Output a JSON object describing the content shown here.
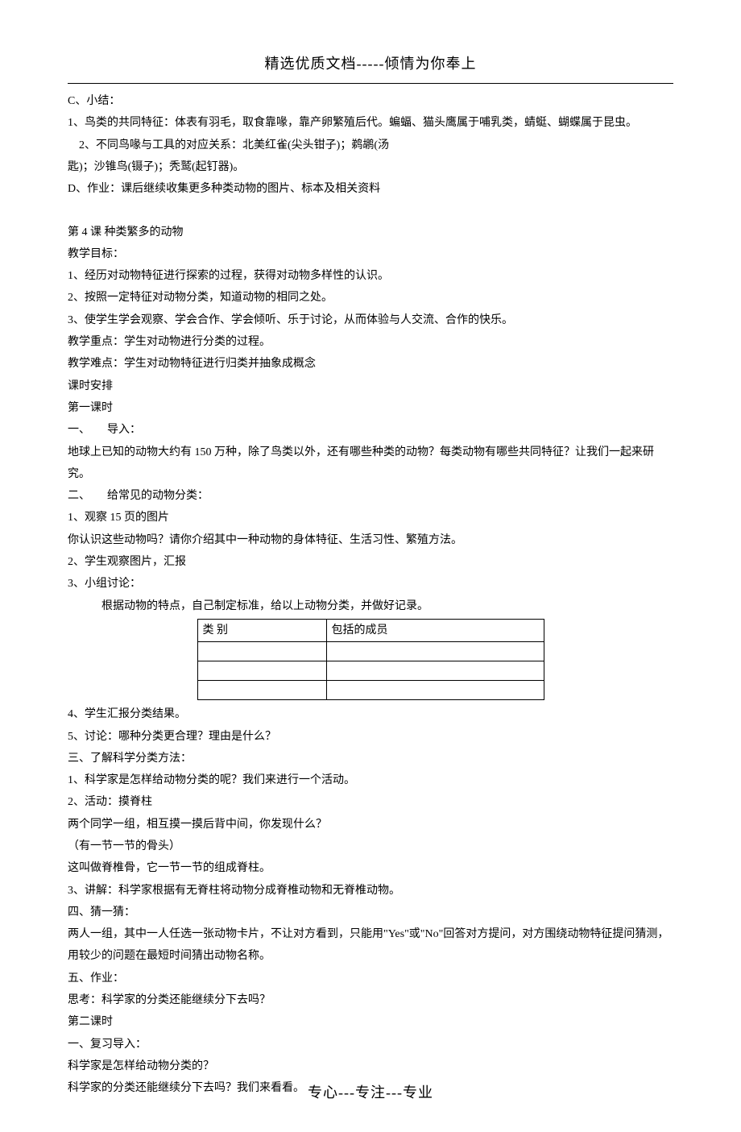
{
  "header": "精选优质文档-----倾情为你奉上",
  "footer": "专心---专注---专业",
  "lines": {
    "c_summary": "C、小结：",
    "c1": "1、鸟类的共同特征：体表有羽毛，取食靠喙，靠产卵繁殖后代。蝙蝠、猫头鹰属于哺乳类，蜻蜓、蝴蝶属于昆虫。",
    "c2a": "2、不同鸟喙与工具的对应关系：北美红雀(尖头钳子)；鹈鹕(汤",
    "c2b": "匙)；沙锥鸟(镊子)；秃鹫(起钉器)。",
    "d_hw": "D、作业：课后继续收集更多种类动物的图片、标本及相关资料",
    "lesson4_title": "第 4 课 种类繁多的动物",
    "obj_label": "教学目标：",
    "obj1": "1、经历对动物特征进行探索的过程，获得对动物多样性的认识。",
    "obj2": "2、按照一定特征对动物分类，知道动物的相同之处。",
    "obj3": "3、使学生学会观察、学会合作、学会倾听、乐于讨论，从而体验与人交流、合作的快乐。",
    "key_point": "教学重点：学生对动物进行分类的过程。",
    "diff_point": "教学难点：学生对动物特征进行归类并抽象成概念",
    "period_label": "课时安排",
    "period1": "第一课时",
    "sec1_label": "一、　　导入：",
    "sec1_text": "地球上已知的动物大约有 150 万种，除了鸟类以外，还有哪些种类的动物？每类动物有哪些共同特征？让我们一起来研究。",
    "sec2_label": "二、　　给常见的动物分类：",
    "sec2_1": "1、观察 15 页的图片",
    "sec2_1a": "你认识这些动物吗？请你介绍其中一种动物的身体特征、生活习性、繁殖方法。",
    "sec2_2": "2、学生观察图片，汇报",
    "sec2_3": "3、小组讨论：",
    "sec2_3a": "根据动物的特点，自己制定标准，给以上动物分类，并做好记录。",
    "th1": "类  别",
    "th2": "包括的成员",
    "sec2_4": "4、学生汇报分类结果。",
    "sec2_5": "5、讨论：哪种分类更合理？理由是什么？",
    "sec3_label": "三、了解科学分类方法：",
    "sec3_1": "1、科学家是怎样给动物分类的呢？我们来进行一个活动。",
    "sec3_2": "2、活动：摸脊柱",
    "sec3_2a": "两个同学一组，相互摸一摸后背中间，你发现什么？",
    "sec3_2b": "（有一节一节的骨头）",
    "sec3_2c": "这叫做脊椎骨，它一节一节的组成脊柱。",
    "sec3_3": "3、讲解：科学家根据有无脊柱将动物分成脊椎动物和无脊椎动物。",
    "sec4_label": "四、猜一猜：",
    "sec4_text": "两人一组，其中一人任选一张动物卡片，不让对方看到，只能用\"Yes\"或\"No\"回答对方提问，对方围绕动物特征提问猜测，用较少的问题在最短时间猜出动物名称。",
    "sec5_label": "五、作业：",
    "sec5_text": "思考：科学家的分类还能继续分下去吗？",
    "period2": "第二课时",
    "review_label": "一、复习导入：",
    "review_q1": "科学家是怎样给动物分类的？",
    "review_q2": "科学家的分类还能继续分下去吗？我们来看看。"
  }
}
